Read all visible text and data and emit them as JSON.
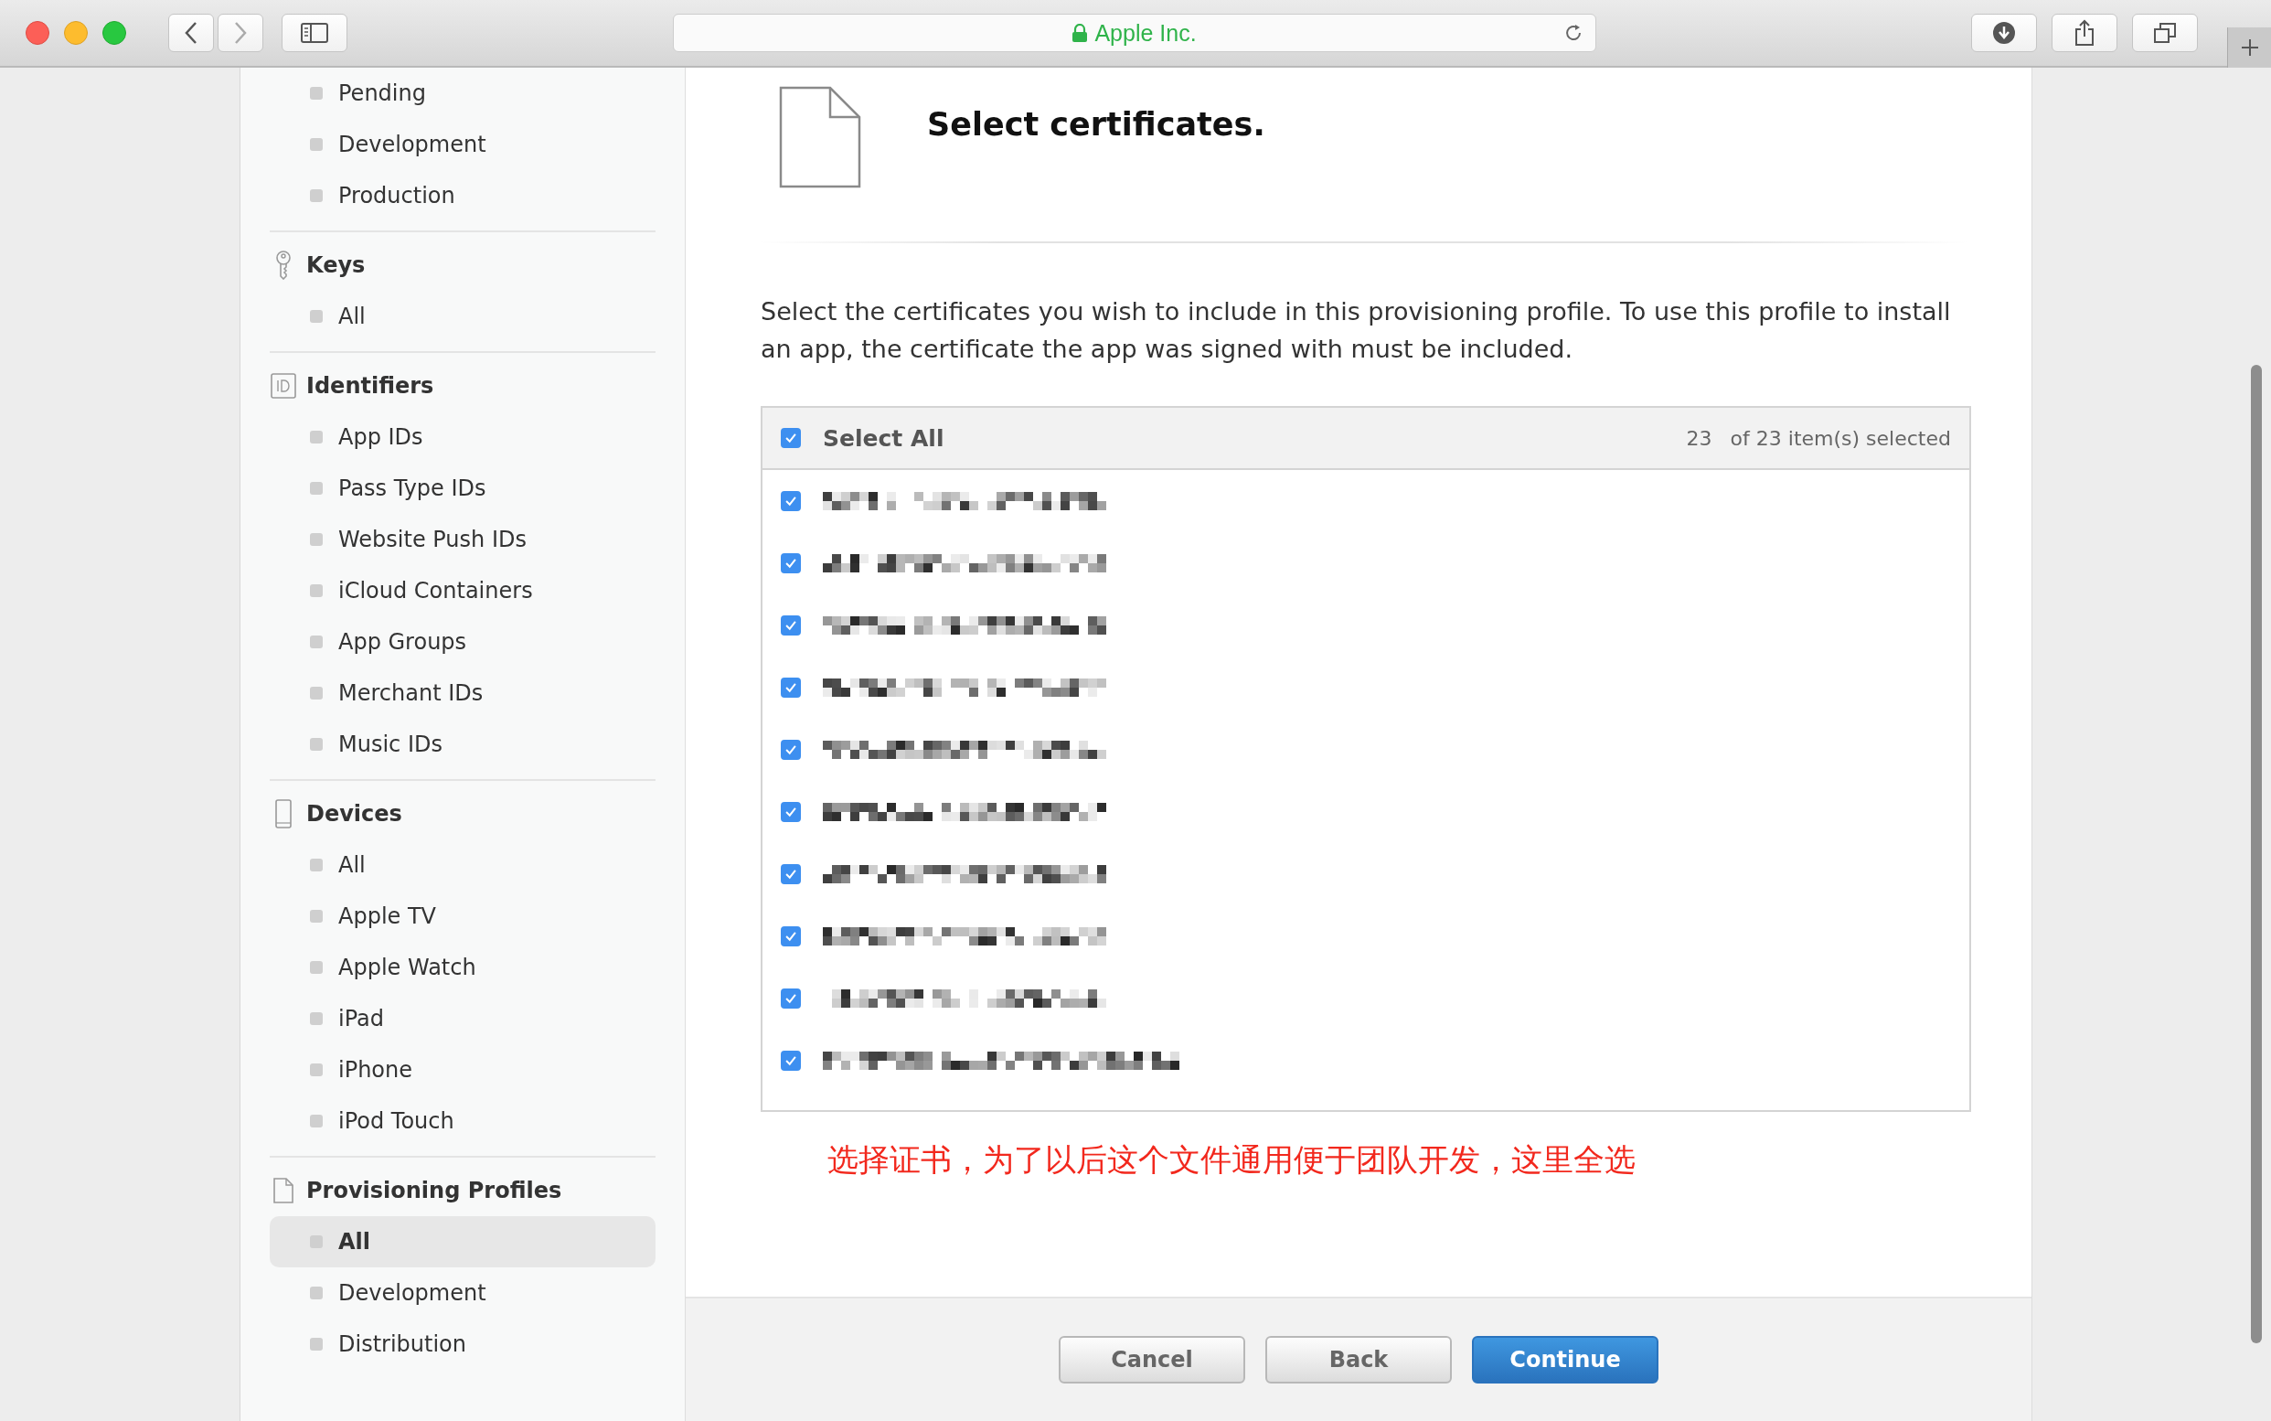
{
  "browser": {
    "address": "Apple Inc."
  },
  "sidebar": {
    "sections": [
      {
        "items": [
          {
            "label": "Pending",
            "selected": false
          },
          {
            "label": "Development",
            "selected": false
          },
          {
            "label": "Production",
            "selected": false
          }
        ]
      },
      {
        "title": "Keys",
        "items": [
          {
            "label": "All",
            "selected": false
          }
        ]
      },
      {
        "title": "Identifiers",
        "items": [
          {
            "label": "App IDs",
            "selected": false
          },
          {
            "label": "Pass Type IDs",
            "selected": false
          },
          {
            "label": "Website Push IDs",
            "selected": false
          },
          {
            "label": "iCloud Containers",
            "selected": false
          },
          {
            "label": "App Groups",
            "selected": false
          },
          {
            "label": "Merchant IDs",
            "selected": false
          },
          {
            "label": "Music IDs",
            "selected": false
          }
        ]
      },
      {
        "title": "Devices",
        "items": [
          {
            "label": "All",
            "selected": false
          },
          {
            "label": "Apple TV",
            "selected": false
          },
          {
            "label": "Apple Watch",
            "selected": false
          },
          {
            "label": "iPad",
            "selected": false
          },
          {
            "label": "iPhone",
            "selected": false
          },
          {
            "label": "iPod Touch",
            "selected": false
          }
        ]
      },
      {
        "title": "Provisioning Profiles",
        "items": [
          {
            "label": "All",
            "selected": true
          },
          {
            "label": "Development",
            "selected": false
          },
          {
            "label": "Distribution",
            "selected": false
          }
        ]
      }
    ]
  },
  "main": {
    "title": "Select certificates.",
    "description": "Select the certificates you wish to include in this provisioning profile. To use this profile to install an app, the certificate the app was signed with must be included.",
    "table": {
      "select_all": {
        "label": "Select All",
        "checked": true
      },
      "count": "23",
      "count_label": "of 23 item(s) selected",
      "rows": [
        {
          "checked": true
        },
        {
          "checked": true
        },
        {
          "checked": true
        },
        {
          "checked": true
        },
        {
          "checked": true
        },
        {
          "checked": true
        },
        {
          "checked": true
        },
        {
          "checked": true
        },
        {
          "checked": true
        },
        {
          "checked": true
        }
      ]
    },
    "note": "选择证书，为了以后这个文件通用便于团队开发，这里全选",
    "buttons": [
      {
        "label": "Cancel",
        "kind": "secondary"
      },
      {
        "label": "Back",
        "kind": "secondary"
      },
      {
        "label": "Continue",
        "kind": "primary"
      }
    ]
  }
}
